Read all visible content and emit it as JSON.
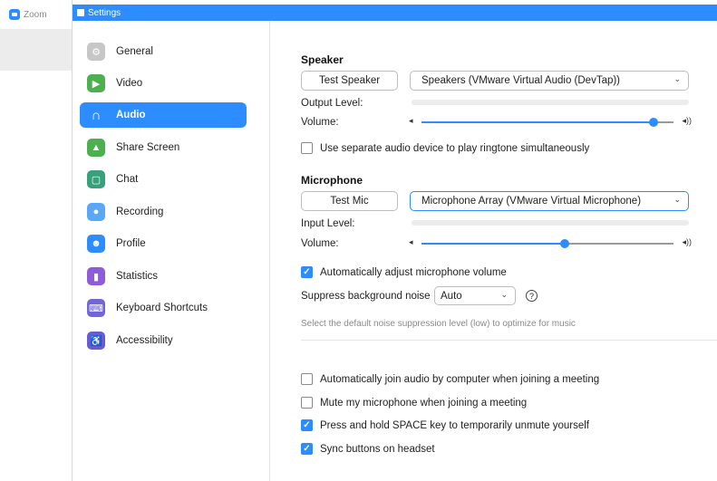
{
  "background_app": {
    "title": "Zoom"
  },
  "window": {
    "title": "Settings"
  },
  "sidebar": {
    "items": [
      {
        "label": "General",
        "icon": "gear-icon",
        "color": "#c7c7c7",
        "glyph": "⚙"
      },
      {
        "label": "Video",
        "icon": "video-camera-icon",
        "color": "#4caf50",
        "glyph": "▶"
      },
      {
        "label": "Audio",
        "icon": "headphones-icon",
        "color": "#2d8cff",
        "glyph": "∩",
        "active": true
      },
      {
        "label": "Share Screen",
        "icon": "share-screen-icon",
        "color": "#4caf50",
        "glyph": "▲"
      },
      {
        "label": "Chat",
        "icon": "chat-bubble-icon",
        "color": "#37a17b",
        "glyph": "▢"
      },
      {
        "label": "Recording",
        "icon": "recording-icon",
        "color": "#5aa8f5",
        "glyph": "●"
      },
      {
        "label": "Profile",
        "icon": "profile-icon",
        "color": "#2d8cff",
        "glyph": "☻"
      },
      {
        "label": "Statistics",
        "icon": "statistics-icon",
        "color": "#8e5cd9",
        "glyph": "▮"
      },
      {
        "label": "Keyboard Shortcuts",
        "icon": "keyboard-icon",
        "color": "#7266d8",
        "glyph": "⌨"
      },
      {
        "label": "Accessibility",
        "icon": "accessibility-icon",
        "color": "#6b5bd3",
        "glyph": "♿"
      }
    ]
  },
  "speaker": {
    "title": "Speaker",
    "test_button": "Test Speaker",
    "device": "Speakers (VMware Virtual Audio (DevTap))",
    "output_level_label": "Output Level:",
    "volume_label": "Volume:",
    "volume_level": 0.92
  },
  "ringtone_checkbox": {
    "label": "Use separate audio device to play ringtone simultaneously",
    "checked": false
  },
  "microphone": {
    "title": "Microphone",
    "test_button": "Test Mic",
    "device": "Microphone Array (VMware Virtual Microphone)",
    "input_level_label": "Input Level:",
    "volume_label": "Volume:",
    "volume_level": 0.57
  },
  "auto_adjust_checkbox": {
    "label": "Automatically adjust microphone volume",
    "checked": true
  },
  "noise": {
    "label": "Suppress background noise",
    "value": "Auto",
    "help_glyph": "?",
    "hint": "Select the default noise suppression level (low) to optimize for music"
  },
  "options": [
    {
      "label": "Automatically join audio by computer when joining a meeting",
      "checked": false
    },
    {
      "label": "Mute my microphone when joining a meeting",
      "checked": false
    },
    {
      "label": "Press and hold SPACE key to temporarily unmute yourself",
      "checked": true
    },
    {
      "label": "Sync buttons on headset",
      "checked": true
    }
  ],
  "colors": {
    "accent": "#2d8cff"
  }
}
